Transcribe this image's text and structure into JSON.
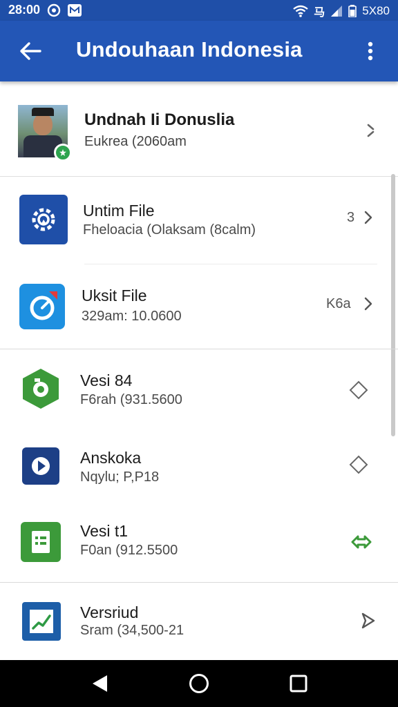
{
  "status_bar": {
    "time": "28:00",
    "right_text": "ᴰʳʳ",
    "right_label": "5X80",
    "carrier_glyph": "马"
  },
  "app_bar": {
    "title": "Undouhaan Indonesia",
    "back_icon": "arrow-left-icon",
    "more_icon": "more-vertical-icon"
  },
  "profile": {
    "name": "Undnah Ii Donuslia",
    "subtitle": "Eukrea (2060am"
  },
  "items": [
    {
      "title": "Untim File",
      "subtitle": "Fheloacia (Olaksam (8calm)",
      "meta": "3",
      "icon": "gear-icon",
      "icon_bg": "#1f4fa8",
      "action": "chevron-right-icon"
    },
    {
      "title": "Uksit File",
      "subtitle": "329am: 10.0600",
      "meta": "K6a",
      "icon": "compass-icon",
      "icon_bg": "#1e90e0",
      "action": "chevron-right-icon"
    },
    {
      "title": "Vesi 84",
      "subtitle": "F6rah (931.5600",
      "meta": "",
      "icon": "camera-icon",
      "icon_bg": "#3c9a3a",
      "action": "diamond-icon"
    },
    {
      "title": "Anskoka",
      "subtitle": "Nqylu; P,P18",
      "meta": "",
      "icon": "play-icon",
      "icon_bg": "#1d3f86",
      "action": "diamond-icon"
    },
    {
      "title": "Vesi t1",
      "subtitle": "F0an (912.5500",
      "meta": "",
      "icon": "sheet-icon",
      "icon_bg": "#3c9a3a",
      "action": "sync-icon"
    },
    {
      "title": "Versriud",
      "subtitle": "Sram (34,500-21",
      "meta": "",
      "icon": "chart-icon",
      "icon_bg": "#1d5ea8",
      "action": "send-icon"
    }
  ],
  "colors": {
    "primary": "#2356b6",
    "status": "#1f4fa8",
    "accent_green": "#3c9a3a"
  }
}
